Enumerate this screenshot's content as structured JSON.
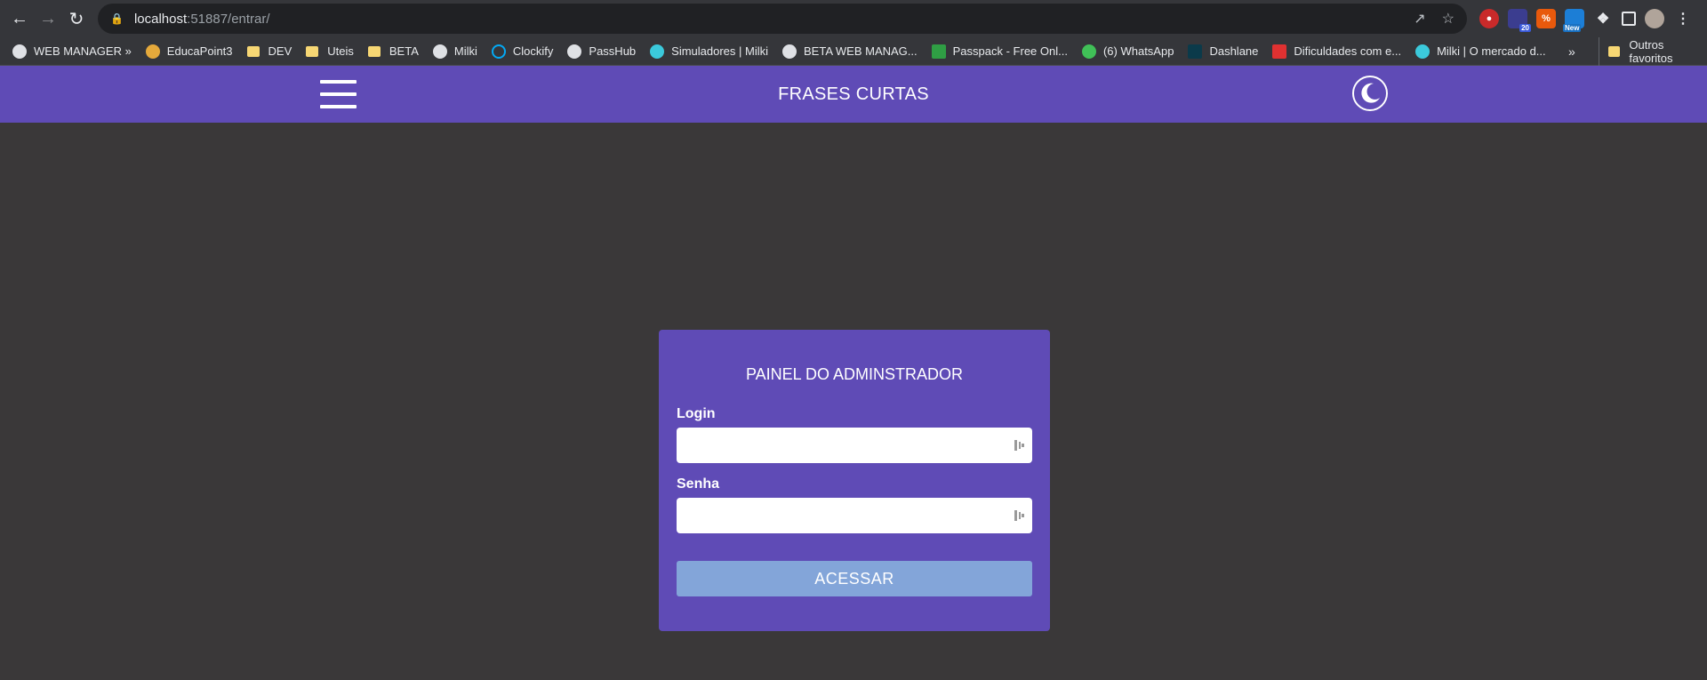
{
  "browser": {
    "url_host": "localhost",
    "url_rest": ":51887/entrar/",
    "ext_badges": [
      "20",
      "New"
    ]
  },
  "bookmarks": {
    "items": [
      {
        "label": "WEB MANAGER »",
        "icon": "globe-icon"
      },
      {
        "label": "EducaPoint3",
        "icon": "educapoint-icon"
      },
      {
        "label": "DEV",
        "icon": "folder-icon"
      },
      {
        "label": "Uteis",
        "icon": "folder-icon"
      },
      {
        "label": "BETA",
        "icon": "folder-icon"
      },
      {
        "label": "Milki",
        "icon": "globe-icon"
      },
      {
        "label": "Clockify",
        "icon": "clockify-icon"
      },
      {
        "label": "PassHub",
        "icon": "globe-icon"
      },
      {
        "label": "Simuladores | Milki",
        "icon": "milki-icon"
      },
      {
        "label": "BETA WEB MANAG...",
        "icon": "globe-icon"
      },
      {
        "label": "Passpack - Free Onl...",
        "icon": "passpack-icon"
      },
      {
        "label": "(6) WhatsApp",
        "icon": "whatsapp-icon"
      },
      {
        "label": "Dashlane",
        "icon": "dashlane-icon"
      },
      {
        "label": "Dificuldades com e...",
        "icon": "bookmark-icon"
      },
      {
        "label": "Milki | O mercado d...",
        "icon": "milki-icon"
      }
    ],
    "more": "»",
    "others": "Outros favoritos"
  },
  "header": {
    "title": "FRASES CURTAS"
  },
  "login": {
    "title": "PAINEL DO ADMINSTRADOR",
    "login_label": "Login",
    "login_value": "",
    "password_label": "Senha",
    "password_value": "",
    "submit_label": "ACESSAR"
  },
  "colors": {
    "header_bg": "#5f4bb6",
    "page_bg": "#3a3839",
    "button_bg": "#83a5d9"
  }
}
